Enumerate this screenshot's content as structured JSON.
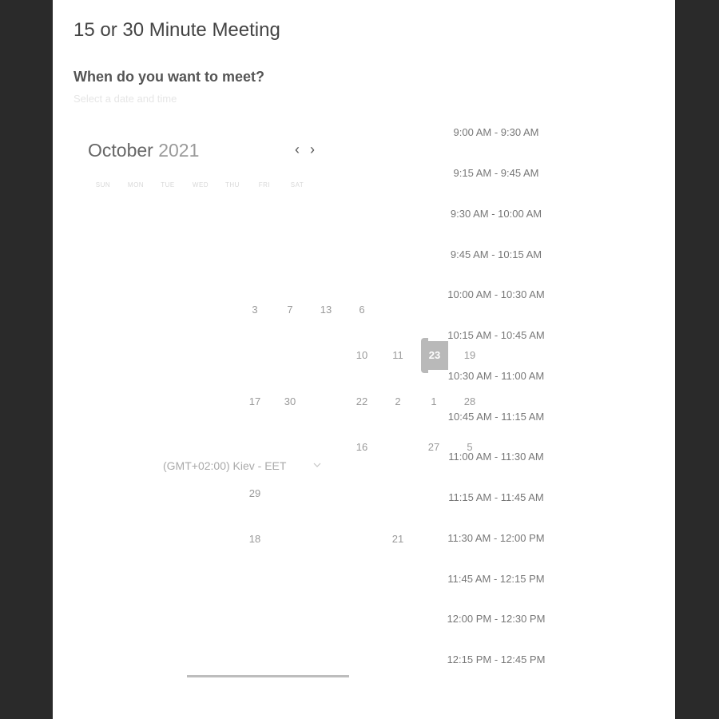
{
  "meeting_title": "15 or 30 Minute Meeting",
  "question": "When do you want to meet?",
  "subtitle": "Select a date and time",
  "calendar": {
    "month": "October",
    "year": "2021",
    "prev_icon": "chevron-left-icon",
    "next_icon": "chevron-right-icon",
    "weekdays": [
      "SUN",
      "MON",
      "TUE",
      "WED",
      "THU",
      "FRI",
      "SAT"
    ],
    "days": [
      "3",
      "7",
      "13",
      "6",
      "10",
      "11",
      "23",
      "19",
      "17",
      "30",
      "22",
      "2",
      "1",
      "28",
      "16",
      "27",
      "5",
      "29",
      "18",
      "21"
    ],
    "selected_day": "23"
  },
  "timezone": {
    "value": "(GMT+02:00) Kiev - EET",
    "icon": "chevron-down-icon"
  },
  "time_slots": [
    "9:00 AM - 9:30 AM",
    "9:15 AM - 9:45 AM",
    "9:30 AM - 10:00 AM",
    "9:45 AM - 10:15 AM",
    "10:00 AM - 10:30 AM",
    "10:15 AM - 10:45 AM",
    "10:30 AM - 11:00 AM",
    "10:45 AM - 11:15 AM",
    "11:00 AM - 11:30 AM",
    "11:15 AM - 11:45 AM",
    "11:30 AM - 12:00 PM",
    "11:45 AM - 12:15 PM",
    "12:00 PM - 12:30 PM",
    "12:15 PM - 12:45 PM"
  ],
  "colors": {
    "background": "#2a2a2a",
    "panel": "#ffffff",
    "selected_day": "#b9b9b9"
  }
}
